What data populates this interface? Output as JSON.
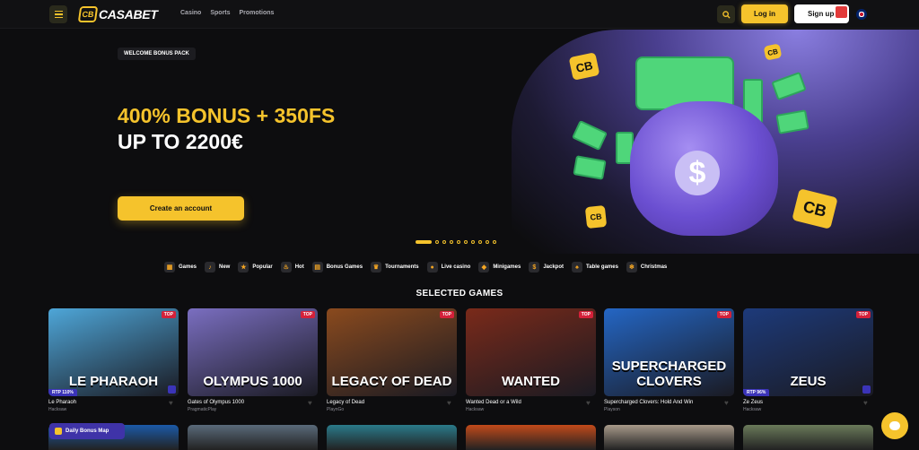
{
  "header": {
    "logo_mark": "CB",
    "logo_text": "CASABET",
    "nav": [
      "Casino",
      "Sports",
      "Promotions"
    ],
    "login_label": "Log in",
    "signup_label": "Sign up"
  },
  "hero": {
    "badge": "WELCOME BONUS PACK",
    "line1": "400% BONUS + 350FS",
    "line2": "UP TO 2200€",
    "cta_label": "Create an account",
    "dots_total": 10,
    "dot_active": 1,
    "coin_text": "CB"
  },
  "categories": [
    {
      "label": "Games",
      "icon": "games-icon"
    },
    {
      "label": "New",
      "icon": "bell-icon"
    },
    {
      "label": "Popular",
      "icon": "star-icon"
    },
    {
      "label": "Hot",
      "icon": "fire-icon"
    },
    {
      "label": "Bonus Games",
      "icon": "bonus-icon"
    },
    {
      "label": "Tournaments",
      "icon": "trophy-icon"
    },
    {
      "label": "Live casino",
      "icon": "live-icon"
    },
    {
      "label": "Minigames",
      "icon": "minigames-icon"
    },
    {
      "label": "Jackpot",
      "icon": "jackpot-icon"
    },
    {
      "label": "Table games",
      "icon": "cards-icon"
    },
    {
      "label": "Christmas",
      "icon": "christmas-icon"
    }
  ],
  "section_title": "SELECTED GAMES",
  "games": [
    {
      "name": "Le Pharaoh",
      "provider": "Hacksaw",
      "art": "LE PHARAOH",
      "badge": "TOP",
      "rtp": "RTP 110%",
      "bg": "#4ea6d8"
    },
    {
      "name": "Gates of Olympus 1000",
      "provider": "PragmaticPlay",
      "art": "OLYMPUS 1000",
      "badge": "TOP",
      "rtp": "",
      "bg": "#7a6ec0"
    },
    {
      "name": "Legacy of Dead",
      "provider": "PlaynGo",
      "art": "LEGACY OF DEAD",
      "badge": "TOP",
      "rtp": "",
      "bg": "#8a4a1e"
    },
    {
      "name": "Wanted Dead or a Wild",
      "provider": "Hacksaw",
      "art": "WANTED",
      "badge": "TOP",
      "rtp": "",
      "bg": "#7a2a1a"
    },
    {
      "name": "Supercharged Clovers: Hold And Win",
      "provider": "Playson",
      "art": "SUPERCHARGED CLOVERS",
      "badge": "TOP",
      "rtp": "",
      "bg": "#2466c4"
    },
    {
      "name": "Ze Zeus",
      "provider": "Hacksaw",
      "art": "ZEUS",
      "badge": "TOP",
      "rtp": "RTP 96%",
      "bg": "#1d3a7a"
    }
  ],
  "row2_colors": [
    "#1b5aa8",
    "#5a6a7a",
    "#2a7a8a",
    "#c24a1a",
    "#a89a8a",
    "#6a7a5a"
  ],
  "bonus_map_label": "Daily Bonus Map",
  "colors": {
    "accent": "#f5c32c",
    "hot": "#d4213a",
    "purple": "#3f33a8"
  }
}
